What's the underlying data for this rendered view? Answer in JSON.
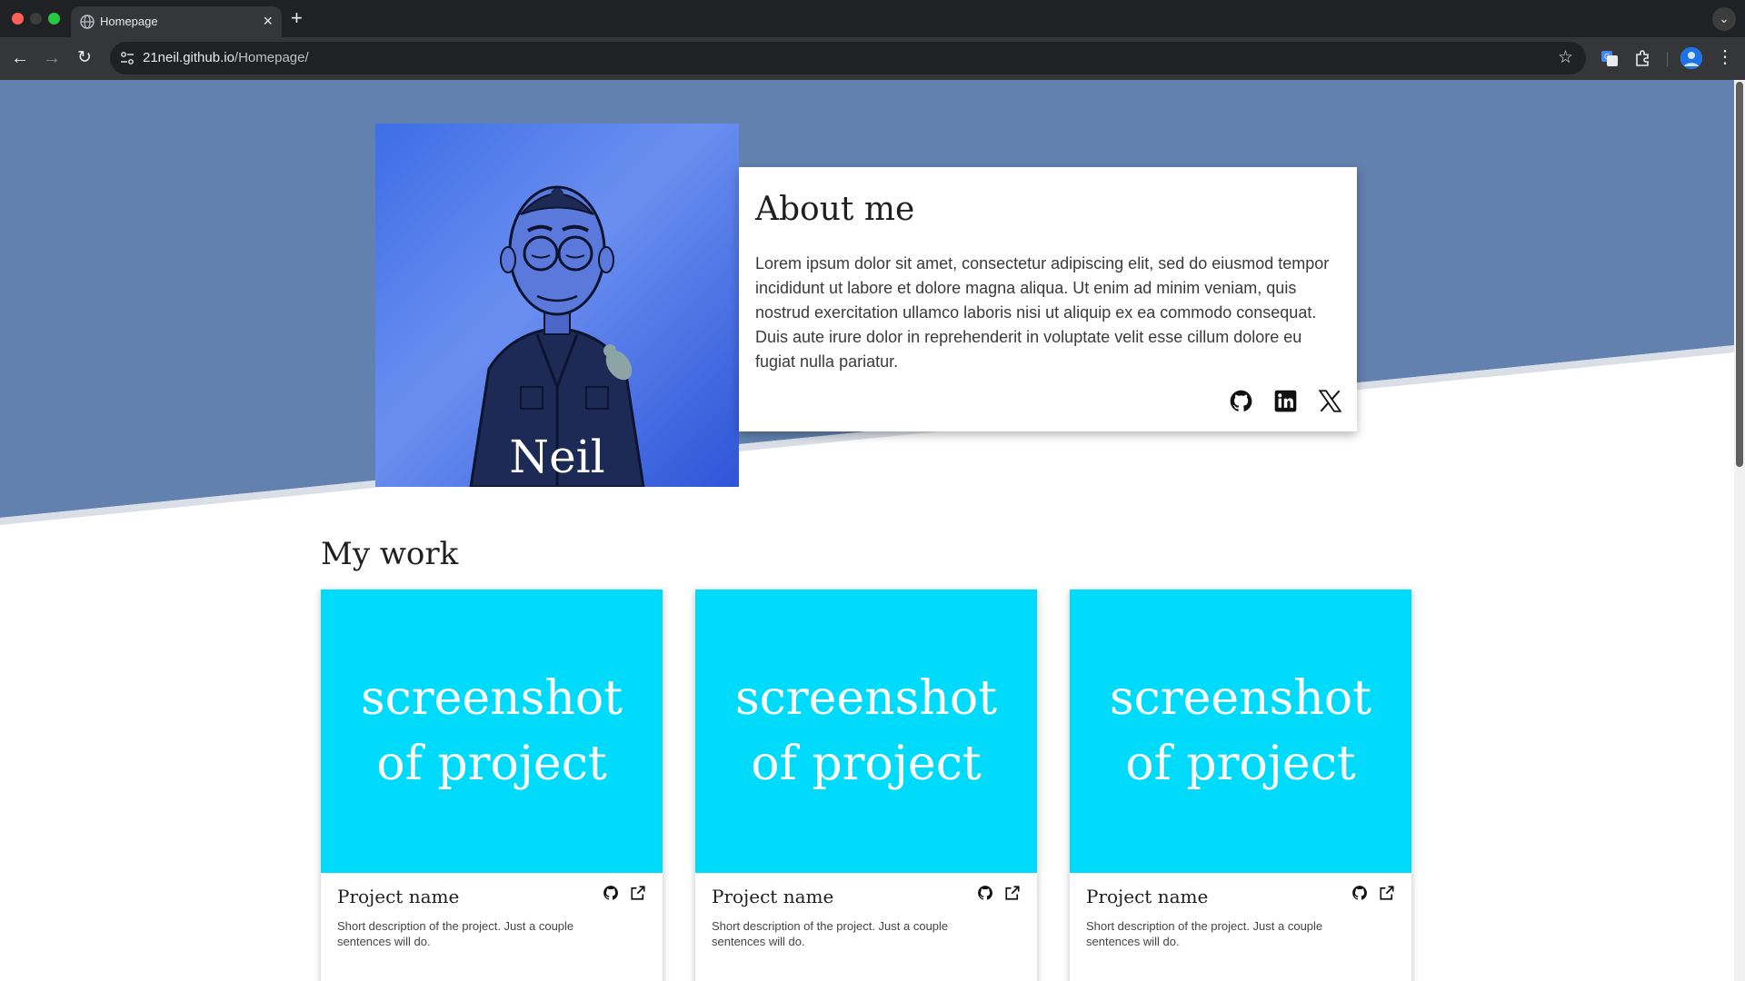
{
  "browser": {
    "tab_title": "Homepage",
    "url_host": "21neil.github.io",
    "url_path": "/Homepage/"
  },
  "colors": {
    "hero_blue": "#6281ae",
    "card_cyan": "#00dafb",
    "photo_blue": "#4a76e8"
  },
  "hero": {
    "name": "Neil",
    "about_title": "About me",
    "about_text": "Lorem ipsum dolor sit amet, consectetur adipiscing elit, sed do eiusmod tempor incididunt ut labore et dolore magna aliqua. Ut enim ad minim veniam, quis nostrud exercitation ullamco laboris nisi ut aliquip ex ea commodo consequat. Duis aute irure dolor in reprehenderit in voluptate velit esse cillum dolore eu fugiat nulla pariatur.",
    "social_icons": [
      "github-icon",
      "linkedin-icon",
      "x-icon"
    ]
  },
  "work": {
    "title": "My work",
    "projects": [
      {
        "image_text": "screenshot of project",
        "name": "Project name",
        "description": "Short description of the project. Just a couple sentences will do."
      },
      {
        "image_text": "screenshot of project",
        "name": "Project name",
        "description": "Short description of the project. Just a couple sentences will do."
      },
      {
        "image_text": "screenshot of project",
        "name": "Project name",
        "description": "Short description of the project. Just a couple sentences will do."
      }
    ]
  }
}
